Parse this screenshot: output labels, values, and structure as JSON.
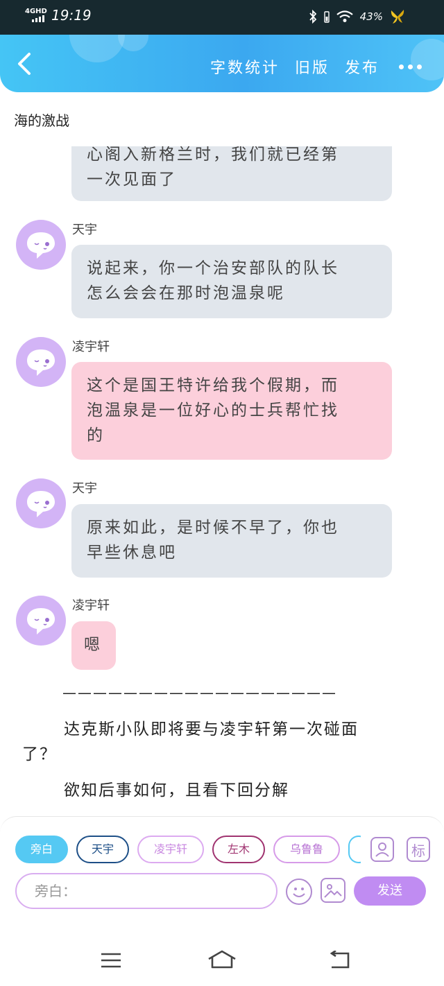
{
  "status_bar": {
    "network": "4GHD",
    "time": "19:19",
    "battery": "43%"
  },
  "header": {
    "back_icon": "chevron-left-icon",
    "actions": [
      "字数统计",
      "旧版",
      "发布"
    ],
    "more_icon": "more-dots-icon"
  },
  "story_title": "海的激战",
  "messages": [
    {
      "speaker": "",
      "text_lines": [
        "心阁入新格兰时，我们就已经第",
        "一次见面了"
      ],
      "style": "gray"
    },
    {
      "speaker": "天宇",
      "text_lines": [
        "说起来，你一个治安部队的队长",
        "怎么会会在那时泡温泉呢"
      ],
      "style": "gray"
    },
    {
      "speaker": "凌宇轩",
      "text_lines": [
        "这个是国王特许给我个假期，而",
        "泡温泉是一位好心的士兵帮忙找",
        "的"
      ],
      "style": "pink"
    },
    {
      "speaker": "天宇",
      "text_lines": [
        "原来如此，是时候不早了，你也",
        "早些休息吧"
      ],
      "style": "gray"
    },
    {
      "speaker": "凌宇轩",
      "text_lines": [
        "嗯"
      ],
      "style": "pink"
    }
  ],
  "divider": "——————————————————",
  "narration": {
    "para1_line1": "达克斯小队即将要与凌宇轩第一次碰面",
    "para1_line2": "了？",
    "para2": "欲知后事如何，且看下回分解"
  },
  "character_chips": [
    {
      "label": "旁白",
      "style": "active"
    },
    {
      "label": "天宇",
      "style": "c-blue"
    },
    {
      "label": "凌宇轩",
      "style": "c-lav"
    },
    {
      "label": "左木",
      "style": "c-plum"
    },
    {
      "label": "乌鲁鲁",
      "style": "c-orchid"
    }
  ],
  "tool_buttons": {
    "mark_label": "标",
    "person_icon": "person-card-icon",
    "emoji_icon": "smiley-icon",
    "image_icon": "image-icon"
  },
  "input": {
    "placeholder": "旁白："
  },
  "send_label": "发送",
  "colors": {
    "header_start": "#45c5f5",
    "header_end": "#3ba8f0",
    "avatar": "#d3b4f6",
    "bubble_gray": "#e1e6ec",
    "bubble_pink": "#fccfdb",
    "send_button": "#c08cf2",
    "active_chip": "#55c9f3"
  }
}
